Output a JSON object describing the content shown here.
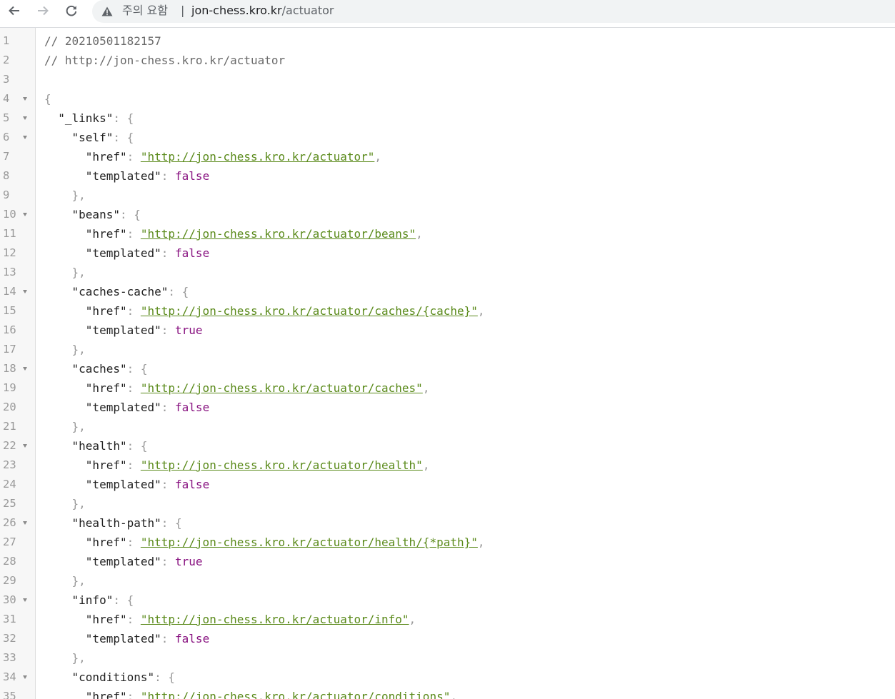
{
  "browser": {
    "back_icon": "arrow-left-icon",
    "forward_icon": "arrow-right-icon",
    "reload_icon": "reload-icon",
    "security_icon": "warning-triangle-icon",
    "security_label": "주의 요함",
    "separator": "|",
    "url_host": "jon-chess.kro.kr",
    "url_path": "/actuator"
  },
  "viewer": {
    "comment_timestamp": "// 20210501182157",
    "comment_url": "// http://jon-chess.kro.kr/actuator",
    "lines": [
      {
        "num": "1"
      },
      {
        "num": "2"
      },
      {
        "num": "3"
      },
      {
        "num": "4"
      },
      {
        "num": "5"
      },
      {
        "num": "6"
      },
      {
        "num": "7"
      },
      {
        "num": "8"
      },
      {
        "num": "9"
      },
      {
        "num": "10"
      },
      {
        "num": "11"
      },
      {
        "num": "12"
      },
      {
        "num": "13"
      },
      {
        "num": "14"
      },
      {
        "num": "15"
      },
      {
        "num": "16"
      },
      {
        "num": "17"
      },
      {
        "num": "18"
      },
      {
        "num": "19"
      },
      {
        "num": "20"
      },
      {
        "num": "21"
      },
      {
        "num": "22"
      },
      {
        "num": "23"
      },
      {
        "num": "24"
      },
      {
        "num": "25"
      },
      {
        "num": "26"
      },
      {
        "num": "27"
      },
      {
        "num": "28"
      },
      {
        "num": "29"
      },
      {
        "num": "30"
      },
      {
        "num": "31"
      },
      {
        "num": "32"
      },
      {
        "num": "33"
      },
      {
        "num": "34"
      },
      {
        "num": "35"
      }
    ],
    "json": {
      "root_key": "\"_links\"",
      "href_key": "\"href\"",
      "templated_key": "\"templated\"",
      "entries": [
        {
          "key": "\"self\"",
          "href": "\"http://jon-chess.kro.kr/actuator\"",
          "templated": "false"
        },
        {
          "key": "\"beans\"",
          "href": "\"http://jon-chess.kro.kr/actuator/beans\"",
          "templated": "false"
        },
        {
          "key": "\"caches-cache\"",
          "href": "\"http://jon-chess.kro.kr/actuator/caches/{cache}\"",
          "templated": "true"
        },
        {
          "key": "\"caches\"",
          "href": "\"http://jon-chess.kro.kr/actuator/caches\"",
          "templated": "false"
        },
        {
          "key": "\"health\"",
          "href": "\"http://jon-chess.kro.kr/actuator/health\"",
          "templated": "false"
        },
        {
          "key": "\"health-path\"",
          "href": "\"http://jon-chess.kro.kr/actuator/health/{*path}\"",
          "templated": "true"
        },
        {
          "key": "\"info\"",
          "href": "\"http://jon-chess.kro.kr/actuator/info\"",
          "templated": "false"
        },
        {
          "key": "\"conditions\"",
          "href": "\"http://jon-chess.kro.kr/actuator/conditions\"",
          "templated": ""
        }
      ]
    },
    "punct": {
      "open_brace": "{",
      "close_brace_comma": "},",
      "colon": ": ",
      "comma": ","
    }
  }
}
